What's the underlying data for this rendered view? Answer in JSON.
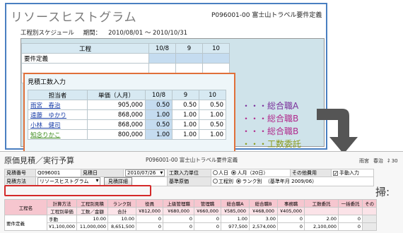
{
  "resource_histogram": {
    "title": "リソースヒストグラム",
    "project": "P096001-00  富士山トラベル要件定義",
    "schedule_label": "工程別スケジュール",
    "period_label": "期間：",
    "period_value": "2010/08/01  〜 2010/10/31",
    "schedule_table": {
      "headers": [
        "工程",
        "10/8",
        "9",
        "10"
      ],
      "rows": [
        {
          "name": "要件定義",
          "values": [
            "",
            "",
            ""
          ]
        },
        {
          "name": "",
          "values": [
            "",
            "",
            ""
          ]
        },
        {
          "name": "",
          "values": [
            "",
            "",
            ""
          ]
        }
      ]
    },
    "estimate": {
      "title": "見積工数入力",
      "headers": [
        "担当者",
        "単価（人月）",
        "10/8",
        "9",
        "10"
      ],
      "rows": [
        {
          "name": "雨宮　春治",
          "price": "905,000",
          "m1": "0.50",
          "m2": "0.50",
          "m3": "0.50"
        },
        {
          "name": "遠藤　ゆかり",
          "price": "868,000",
          "m1": "1.00",
          "m2": "1.00",
          "m3": "1.00"
        },
        {
          "name": "小林　健司",
          "price": "868,000",
          "m1": "0.50",
          "m2": "1.00",
          "m3": "0.50"
        },
        {
          "name": "知念りかこ",
          "price": "800,000",
          "m1": "1.00",
          "m2": "1.00",
          "m3": "1.00"
        }
      ]
    },
    "categories": [
      {
        "dots": "・・・",
        "label": "総合職A",
        "color": "#7a2f9a"
      },
      {
        "dots": "・・・",
        "label": "総合職B",
        "color": "#b02a8c"
      },
      {
        "dots": "・・・",
        "label": "総合職B",
        "color": "#b02a8c"
      },
      {
        "dots": "・・・",
        "label": "工数委託",
        "color": "#8a9a1a"
      }
    ]
  },
  "cost_estimate": {
    "title": "原価見積／実行予算",
    "project": "P096001-00  富士山トラベル要件定義",
    "user": [
      "雨宮",
      "春治",
      "ﾈ 30"
    ],
    "form": {
      "estimate_no_label": "見積番号",
      "estimate_no": "Q096001",
      "estimate_date_label": "見積日",
      "estimate_date": "2010/07/26",
      "unit_label": "工数入力単位",
      "unit_opt1": "人日",
      "unit_opt2": "人月（20日）",
      "other_cost_label": "その他費用",
      "manual_input_label": "手動入力",
      "method_label": "見積方法",
      "method_value": "リソースヒストグラム",
      "detail_button": "見積詳細",
      "base_price_label": "基準原価",
      "base_opt1": "工程別",
      "base_opt2": "ランク別",
      "base_year": "（基準年月 2009/06）",
      "big_char": "掃:"
    },
    "table": {
      "header1": [
        "工程名",
        "計算方法",
        "工程別見積",
        "ランク別",
        "役員",
        "上級管理職",
        "管理職",
        "総合職A",
        "総合職B",
        "事務職",
        "工数委託",
        "一括委託",
        "その"
      ],
      "header2": [
        "",
        "工程別単価",
        "工数／金額",
        "合計",
        "Ұ812,000",
        "Ұ680,000",
        "Ұ660,000",
        "Ұ585,000",
        "Ұ468,000",
        "Ұ405,000",
        "",
        "",
        ""
      ],
      "row_name": "要件定義",
      "row1": [
        "手動",
        "10.00",
        "10.00",
        "0",
        "0",
        "0",
        "1.00",
        "3.00",
        "0",
        "2.00",
        "",
        "0"
      ],
      "row2": [
        "Ұ1,100,000",
        "11,000,000",
        "8,651,500",
        "0",
        "0",
        "0",
        "977,500",
        "2,574,000",
        "0",
        "2,100,000",
        "",
        "0"
      ]
    }
  },
  "colors": {
    "top_border": "#4a7fc1",
    "estimate_border": "#e0703a",
    "method_highlight": "#d42a2a",
    "arrow": "#555555",
    "header_pink": "#f6c6cf"
  }
}
